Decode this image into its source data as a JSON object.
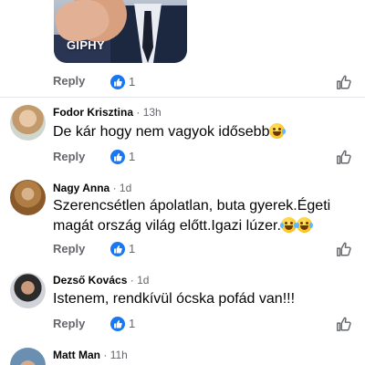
{
  "gif": {
    "label": "GIPHY"
  },
  "actions": {
    "reply_label": "Reply"
  },
  "comments": [
    {
      "author": "",
      "time": "",
      "text": "",
      "likes": "1"
    },
    {
      "author": "Fodor Krisztina",
      "time": "13h",
      "text": "De kár hogy nem vagyok idősebb",
      "likes": "1",
      "emoji": "grinning-face-with-sweat-icon"
    },
    {
      "author": "Nagy Anna",
      "time": "1d",
      "text_line1": "Szerencsétlen ápolatlan, buta gyerek.Égeti",
      "text_line2": "magát ország világ előtt.Igazi lúzer.",
      "likes": "1",
      "emoji": "face-with-tears-of-joy-icon"
    },
    {
      "author": "Dezső Kovács",
      "time": "1d",
      "text": "Istenem, rendkívül ócska pofád van!!!",
      "likes": "1"
    },
    {
      "author": "Matt Man",
      "time": "11h"
    }
  ],
  "separator": "·",
  "colors": {
    "like_blue": "#1877f2",
    "secondary_text": "#65676b",
    "primary_text": "#050505"
  }
}
